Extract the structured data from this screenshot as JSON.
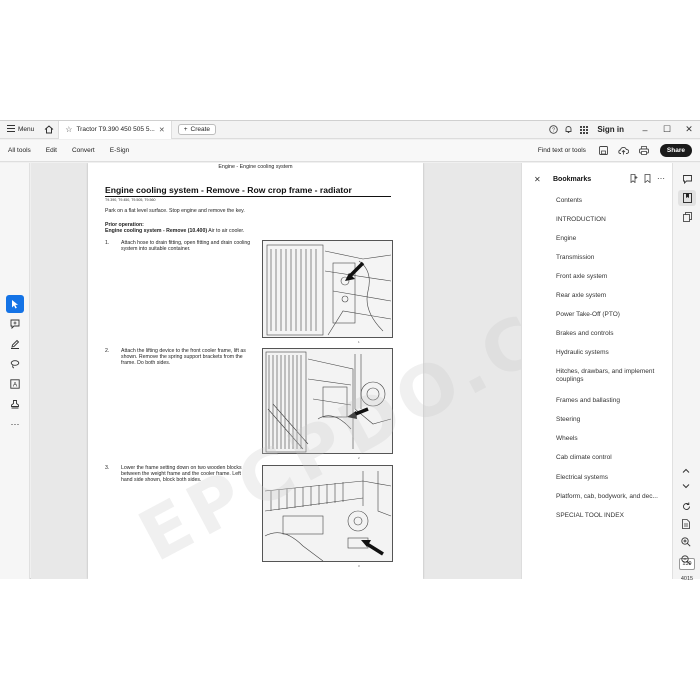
{
  "titlebar": {
    "menu_label": "Menu",
    "tab_title": "Tractor T9.390 450 505 5...",
    "create_label": "Create",
    "signin_label": "Sign in"
  },
  "toolbar": {
    "items": [
      "All tools",
      "Edit",
      "Convert",
      "E-Sign"
    ],
    "find_label": "Find text or tools",
    "share_label": "Share"
  },
  "document": {
    "running_head": "Engine - Engine cooling system",
    "title": "Engine cooling system - Remove - Row crop frame - radiator",
    "models": "T9.390, T9.450, T9.505, T9.560",
    "park_text": "Park on a flat level surface.  Stop engine and remove the key.",
    "prior_heading": "Prior operation:",
    "prior_bold": "Engine cooling system - Remove (10.400)",
    "prior_rest": " Air to air cooler.",
    "steps": [
      {
        "num": "1.",
        "text": "Attach hose to drain fitting, open fitting and drain cooling system into suitable container.",
        "fig_num": "1"
      },
      {
        "num": "2.",
        "text": "Attach the lifting device to the front cooler frame, lift as shown.  Remove the spring support brackets from the frame.  Do both sides.",
        "fig_num": "2"
      },
      {
        "num": "3.",
        "text": "Lower the frame setting down on two wooden blocks between the weight frame and the cooler frame.  Left hand side shown, block both sides.",
        "fig_num": "3"
      }
    ]
  },
  "bookmarks": {
    "title": "Bookmarks",
    "items": [
      "Contents",
      "INTRODUCTION",
      "Engine",
      "Transmission",
      "Front axle system",
      "Rear axle system",
      "Power Take-Off (PTO)",
      "Brakes and controls",
      "Hydraulic systems",
      "Hitches, drawbars, and implement couplings",
      "Frames and ballasting",
      "Steering",
      "Wheels",
      "Cab climate control",
      "Electrical systems",
      "Platform, cab, bodywork, and dec...",
      "SPECIAL TOOL INDEX"
    ]
  },
  "page_nav": {
    "current": "139",
    "total": "4015"
  },
  "watermark": "EPCPDO.COM",
  "colors": {
    "accent": "#1473e6",
    "share_bg": "#1b1b1b"
  }
}
